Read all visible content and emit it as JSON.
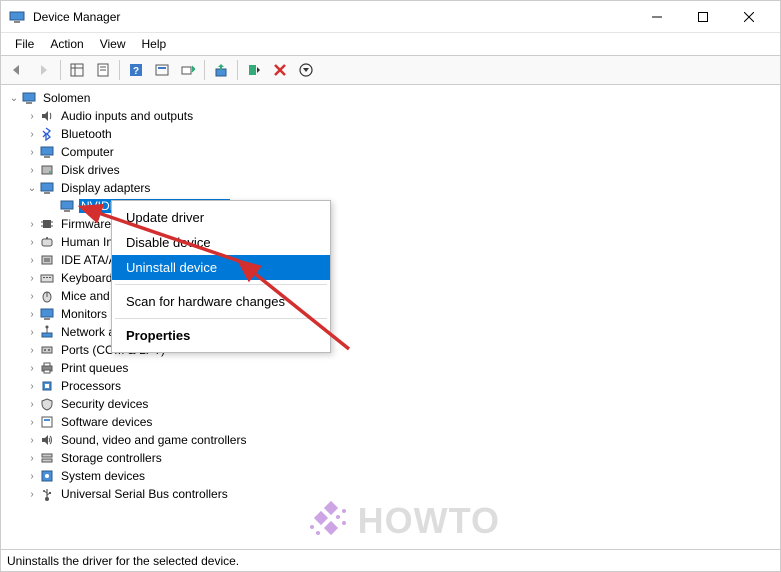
{
  "window": {
    "title": "Device Manager"
  },
  "menubar": {
    "items": [
      "File",
      "Action",
      "View",
      "Help"
    ]
  },
  "tree": {
    "root": "Solomen",
    "nodes": [
      {
        "label": "Audio inputs and outputs",
        "icon": "speaker"
      },
      {
        "label": "Bluetooth",
        "icon": "bluetooth"
      },
      {
        "label": "Computer",
        "icon": "monitor"
      },
      {
        "label": "Disk drives",
        "icon": "disk"
      },
      {
        "label": "Display adapters",
        "icon": "monitor",
        "expanded": true,
        "children": [
          {
            "label": "NVIDIA GeForce GTX 1650",
            "icon": "monitor",
            "selected": true
          }
        ]
      },
      {
        "label": "Firmware",
        "icon": "chip"
      },
      {
        "label": "Human Interface Devices",
        "icon": "hid"
      },
      {
        "label": "IDE ATA/ATAPI controllers",
        "icon": "ide"
      },
      {
        "label": "Keyboards",
        "icon": "keyboard"
      },
      {
        "label": "Mice and other pointing devices",
        "icon": "mouse"
      },
      {
        "label": "Monitors",
        "icon": "monitor"
      },
      {
        "label": "Network adapters",
        "icon": "network"
      },
      {
        "label": "Ports (COM & LPT)",
        "icon": "port"
      },
      {
        "label": "Print queues",
        "icon": "printer"
      },
      {
        "label": "Processors",
        "icon": "cpu"
      },
      {
        "label": "Security devices",
        "icon": "security"
      },
      {
        "label": "Software devices",
        "icon": "software"
      },
      {
        "label": "Sound, video and game controllers",
        "icon": "sound"
      },
      {
        "label": "Storage controllers",
        "icon": "storage"
      },
      {
        "label": "System devices",
        "icon": "system"
      },
      {
        "label": "Universal Serial Bus controllers",
        "icon": "usb"
      }
    ]
  },
  "context_menu": {
    "items": [
      {
        "label": "Update driver"
      },
      {
        "label": "Disable device"
      },
      {
        "label": "Uninstall device",
        "highlighted": true
      },
      {
        "separator": true
      },
      {
        "label": "Scan for hardware changes"
      },
      {
        "separator": true
      },
      {
        "label": "Properties",
        "bold": true
      }
    ]
  },
  "statusbar": {
    "text": "Uninstalls the driver for the selected device."
  },
  "watermark": {
    "text": "HOWTO"
  },
  "colors": {
    "selection": "#0078d7",
    "arrow": "#d32f2f"
  }
}
